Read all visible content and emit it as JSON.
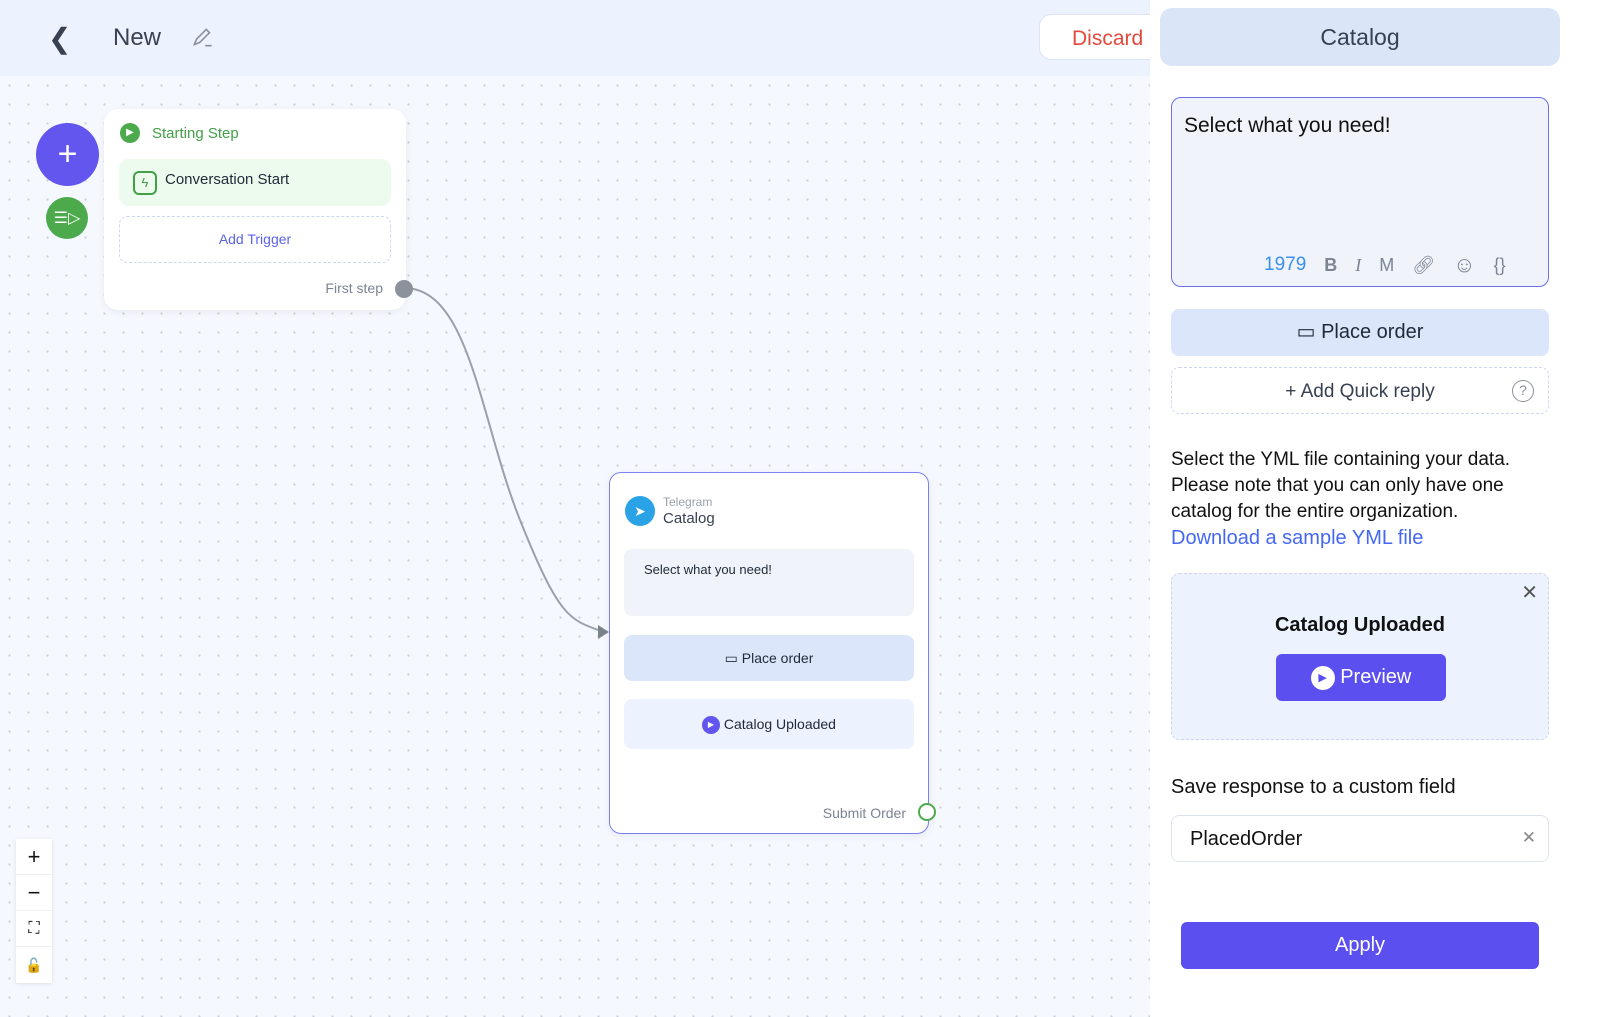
{
  "header": {
    "title": "New",
    "discard_label": "Discard c"
  },
  "start_node": {
    "title": "Starting Step",
    "trigger": "Conversation Start",
    "add_trigger": "Add Trigger",
    "output_label": "First step"
  },
  "catalog_node": {
    "channel": "Telegram",
    "title": "Catalog",
    "message": "Select what you need!",
    "button": "Place order",
    "catalog": "Catalog Uploaded",
    "output_label": "Submit Order"
  },
  "zoom_controls": {
    "zoom_in": "+",
    "zoom_out": "−"
  },
  "panel": {
    "title": "Catalog",
    "message": "Select what you need!",
    "char_count": "1979",
    "toolbar": {
      "bold": "B",
      "italic": "I",
      "mono": "M",
      "variables": "{}"
    },
    "button": "Place order",
    "add_quick_reply": "+ Add Quick reply",
    "help": "?",
    "description": "Select the YML file containing your data. Please note that you can only have one catalog for the entire organization.",
    "download_link": "Download a sample YML file",
    "uploaded_title": "Catalog Uploaded",
    "preview": "Preview",
    "save_label": "Save response to a custom field",
    "custom_field": "PlacedOrder",
    "apply": "Apply"
  },
  "colors": {
    "accent": "#5b4ff0",
    "green": "#4caa4c",
    "telegram": "#2aa3e6",
    "danger": "#e5483c",
    "link": "#4468f2"
  }
}
